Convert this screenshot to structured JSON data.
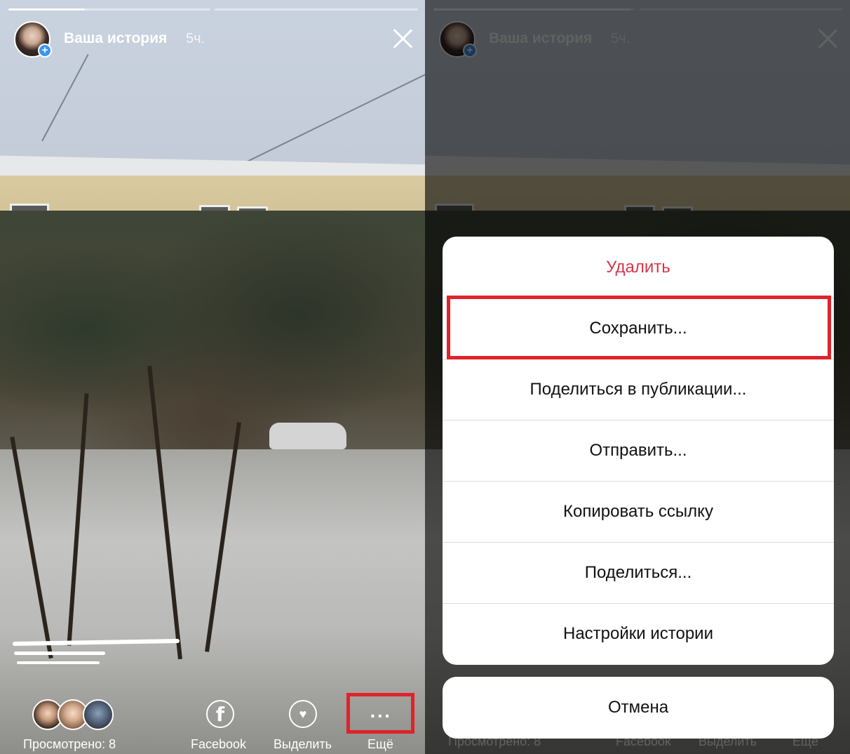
{
  "story": {
    "title": "Ваша история",
    "time": "5ч."
  },
  "bottom_bar": {
    "viewed_label": "Просмотрено: 8",
    "facebook_label": "Facebook",
    "highlight_label": "Выделить",
    "more_label": "Ещё"
  },
  "action_sheet": {
    "items": [
      {
        "label": "Удалить"
      },
      {
        "label": "Сохранить..."
      },
      {
        "label": "Поделиться в публикации..."
      },
      {
        "label": "Отправить..."
      },
      {
        "label": "Копировать ссылку"
      },
      {
        "label": "Поделиться..."
      },
      {
        "label": "Настройки истории"
      }
    ],
    "cancel_label": "Отмена"
  },
  "colors": {
    "destructive": "#d6374a",
    "highlight_box": "#e0232a",
    "plus_badge": "#3897f0"
  },
  "icons": [
    "close-icon",
    "plus-icon",
    "facebook-icon",
    "heart-icon",
    "more-dots-icon"
  ]
}
